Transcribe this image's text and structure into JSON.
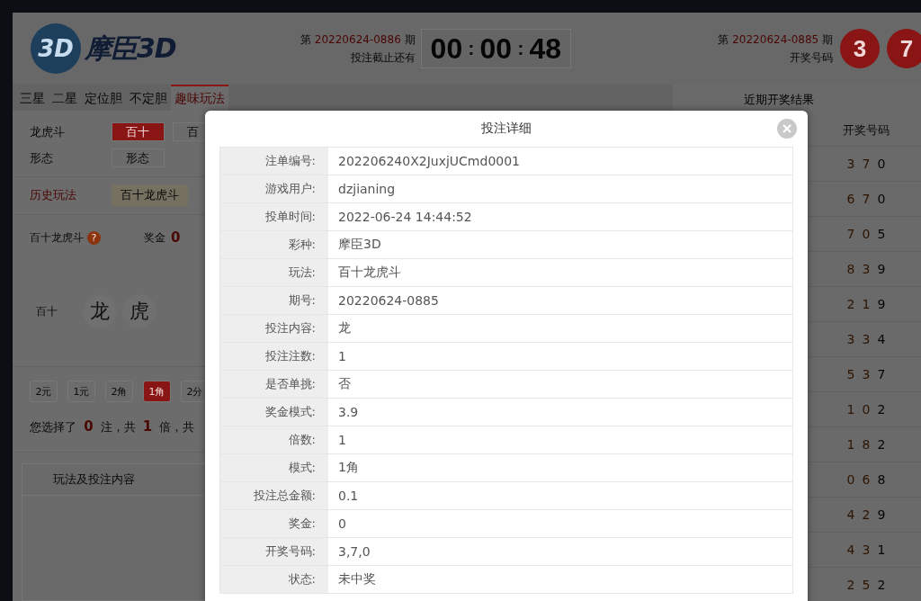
{
  "header": {
    "logo_badge": "3D",
    "logo_text": "摩臣3D",
    "current_issue": {
      "prefix": "第",
      "number": "20220624-0886",
      "suffix": "期",
      "caption": "投注截止还有"
    },
    "countdown": {
      "parts": [
        "00",
        "00",
        "48"
      ],
      "separator": ":"
    },
    "last_issue": {
      "prefix": "第",
      "number": "20220624-0885",
      "suffix": "期",
      "caption": "开奖号码"
    },
    "balls": [
      "3",
      "7"
    ]
  },
  "tabs": [
    {
      "label": "三星",
      "selected": false
    },
    {
      "label": "二星",
      "selected": false
    },
    {
      "label": "定位胆",
      "selected": false
    },
    {
      "label": "不定胆",
      "selected": false
    },
    {
      "label": "趣味玩法",
      "selected": true
    }
  ],
  "play": {
    "rows": [
      {
        "label": "龙虎斗",
        "options": [
          {
            "label": "百十",
            "selected": true
          },
          {
            "label": "百",
            "selected": false
          }
        ]
      },
      {
        "label": "形态",
        "options": [
          {
            "label": "形态",
            "selected": false
          }
        ]
      }
    ],
    "history": {
      "label": "历史玩法",
      "items": [
        "百十龙虎斗"
      ]
    }
  },
  "bet": {
    "name": "百十龙虎斗",
    "help": "?",
    "prize_label": "奖金",
    "prize": "0",
    "position": "百十",
    "choices": [
      {
        "label": "龙",
        "selected": false
      },
      {
        "label": "虎",
        "selected": false
      }
    ]
  },
  "units": [
    {
      "label": "2元",
      "selected": false
    },
    {
      "label": "1元",
      "selected": false
    },
    {
      "label": "2角",
      "selected": false
    },
    {
      "label": "1角",
      "selected": true
    },
    {
      "label": "2分",
      "selected": false
    }
  ],
  "summary": "您选择了 **0** 注，共 **1** 倍，共",
  "orders_table": {
    "columns": [
      "玩法及投注内容"
    ]
  },
  "results": {
    "title": "近期开奖结果",
    "column": "开奖号码",
    "rows": [
      [
        "3",
        "7",
        "0"
      ],
      [
        "6",
        "7",
        "0"
      ],
      [
        "7",
        "0",
        "5"
      ],
      [
        "8",
        "3",
        "9"
      ],
      [
        "2",
        "1",
        "9"
      ],
      [
        "3",
        "3",
        "4"
      ],
      [
        "5",
        "3",
        "7"
      ],
      [
        "1",
        "0",
        "2"
      ],
      [
        "1",
        "8",
        "2"
      ],
      [
        "0",
        "6",
        "8"
      ],
      [
        "4",
        "2",
        "9"
      ],
      [
        "4",
        "3",
        "1"
      ],
      [
        "2",
        "5",
        "2"
      ]
    ]
  },
  "modal": {
    "title": "投注详细",
    "fields": [
      {
        "label": "注单编号:",
        "value": "202206240X2JuxjUCmd0001"
      },
      {
        "label": "游戏用户:",
        "value": "dzjianing"
      },
      {
        "label": "投单时间:",
        "value": "2022-06-24 14:44:52"
      },
      {
        "label": "彩种:",
        "value": "摩臣3D"
      },
      {
        "label": "玩法:",
        "value": "百十龙虎斗"
      },
      {
        "label": "期号:",
        "value": "20220624-0885"
      },
      {
        "label": "投注内容:",
        "value": "龙"
      },
      {
        "label": "投注注数:",
        "value": "1"
      },
      {
        "label": "是否单挑:",
        "value": "否"
      },
      {
        "label": "奖金模式:",
        "value": "3.9"
      },
      {
        "label": "倍数:",
        "value": "1"
      },
      {
        "label": "模式:",
        "value": "1角"
      },
      {
        "label": "投注总金额:",
        "value": "0.1"
      },
      {
        "label": "奖金:",
        "value": "0"
      },
      {
        "label": "开奖号码:",
        "value": "3,7,0"
      },
      {
        "label": "状态:",
        "value": "未中奖"
      }
    ]
  }
}
